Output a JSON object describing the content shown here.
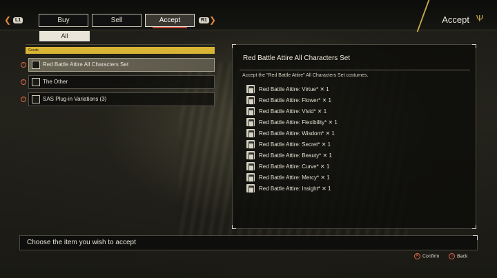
{
  "header": {
    "left_shoulder": "L1",
    "right_shoulder": "R1",
    "tabs": [
      {
        "label": "Buy"
      },
      {
        "label": "Sell"
      },
      {
        "label": "Accept"
      }
    ],
    "title": "Accept",
    "emblem_icon": "trident-emblem-icon"
  },
  "filter": {
    "label": "All",
    "section_label": "Goods"
  },
  "list": {
    "items": [
      {
        "label": "Red Battle Attire All Characters Set"
      },
      {
        "label": "The Other"
      },
      {
        "label": "SAS Plug-in Variations (3)"
      }
    ]
  },
  "detail": {
    "title": "Red Battle Attire All Characters Set",
    "description": "Accept the \"Red Battle Attire\" All Characters Set costumes.",
    "items": [
      {
        "label": "Red Battle Attire: Virtue* ✕ 1"
      },
      {
        "label": "Red Battle Attire: Flower* ✕ 1"
      },
      {
        "label": "Red Battle Attire: Vivid* ✕ 1"
      },
      {
        "label": "Red Battle Attire: Flexibility* ✕ 1"
      },
      {
        "label": "Red Battle Attire: Wisdom* ✕ 1"
      },
      {
        "label": "Red Battle Attire: Secret* ✕ 1"
      },
      {
        "label": "Red Battle Attire: Beauty* ✕ 1"
      },
      {
        "label": "Red Battle Attire: Curve* ✕ 1"
      },
      {
        "label": "Red Battle Attire: Mercy* ✕ 1"
      },
      {
        "label": "Red Battle Attire: Insight* ✕ 1"
      }
    ]
  },
  "footer": {
    "message": "Choose the item you wish to accept",
    "confirm_label": "Confirm",
    "back_label": "Back"
  },
  "colors": {
    "accent_gold": "#d8b535",
    "accent_red": "#c94a3a"
  }
}
